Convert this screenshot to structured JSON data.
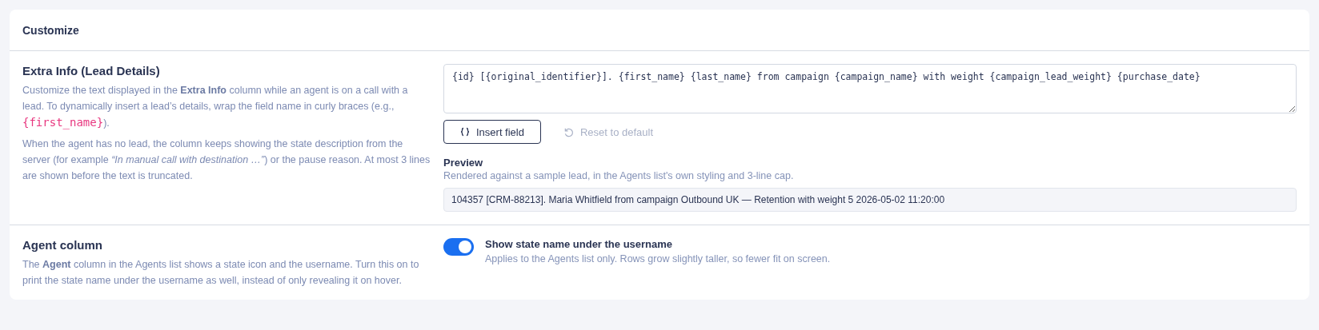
{
  "card": {
    "title": "Customize"
  },
  "sections": [
    {
      "kind": "template",
      "title": "Extra Info (Lead Details)",
      "paragraphs": [
        [
          {
            "kind": "text",
            "text": "Customize the text displayed in the **Extra Info** column while an agent is on a call with a lead. To dynamically insert a lead’s details, wrap the field name in curly braces (e.g., "
          },
          {
            "kind": "code",
            "text": "{first_name}"
          },
          {
            "kind": "text",
            "text": ")."
          }
        ],
        [
          {
            "kind": "text",
            "text": "When the agent has no lead, the column keeps showing the state description from the server (for example *“In manual call with destination …”*) or the pause reason. At most 3 lines are shown before the text is truncated."
          }
        ]
      ],
      "template_value": "{id} [{original_identifier}]. {first_name} {last_name} from campaign {campaign_name} with weight {campaign_lead_weight} {purchase_date}",
      "insert_button": "Insert field",
      "reset_button": {
        "label": "Reset to default",
        "disabled": true
      },
      "preview": {
        "title": "Preview",
        "subtitle": "Rendered against a sample lead, in the Agents list's own styling and 3-line cap.",
        "text": "104357 [CRM-88213]. Maria Whitfield from campaign Outbound UK — Retention with weight 5 2026-05-02 11:20:00"
      }
    },
    {
      "kind": "toggle",
      "title": "Agent column",
      "paragraphs": [
        [
          {
            "kind": "text",
            "text": "The **Agent** column in the Agents list shows a state icon and the username. Turn this on to print the state name under the username as well, instead of only revealing it on hover."
          }
        ]
      ],
      "toggle": {
        "on": true,
        "label": "Show state name under the username",
        "hint": "Applies to the Agents list only. Rows grow slightly taller, so fewer fit on screen."
      }
    }
  ]
}
